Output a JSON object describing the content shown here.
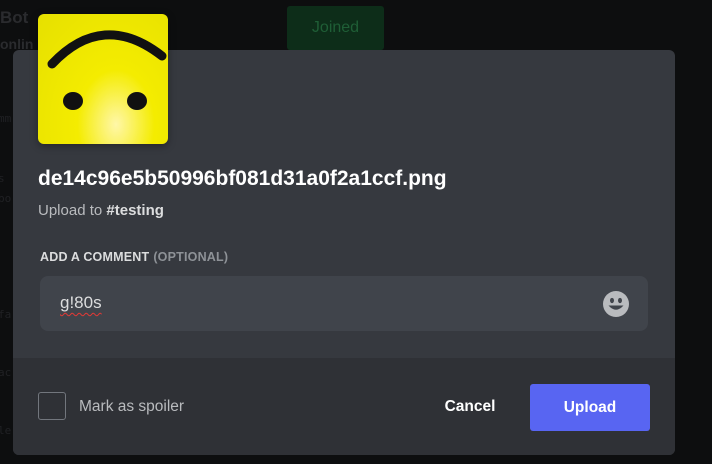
{
  "background": {
    "bot_name": "Bot",
    "status": "onlin",
    "joined_label": "Joined",
    "fragments": [
      "mm",
      "s",
      "bo",
      "fa",
      "ac",
      "le"
    ]
  },
  "upload_modal": {
    "filename": "de14c96e5b50996bf081d31a0f2a1ccf.png",
    "upload_to_prefix": "Upload to ",
    "channel": "#testing",
    "comment_label": "ADD A COMMENT",
    "comment_optional": "(OPTIONAL)",
    "comment_value": "g!80s",
    "emoji_icon": "smiley-face-icon",
    "spoiler_label": "Mark as spoiler",
    "spoiler_checked": false,
    "cancel_label": "Cancel",
    "upload_label": "Upload"
  },
  "colors": {
    "accent": "#5865f2",
    "modal_bg": "#36393f",
    "footer_bg": "#2f3136",
    "input_bg": "#40444b"
  }
}
